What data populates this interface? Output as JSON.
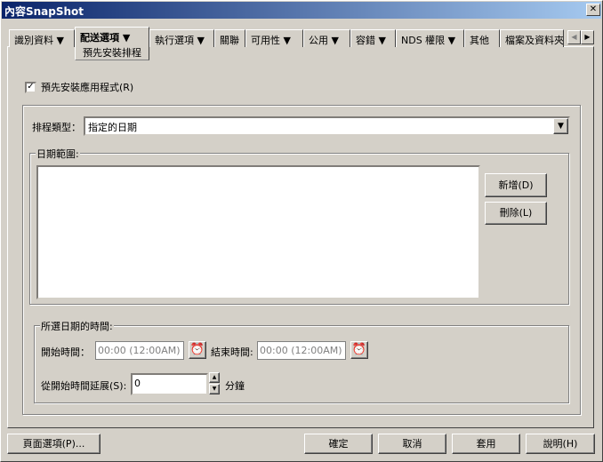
{
  "window": {
    "title": "內容SnapShot",
    "close": "✕"
  },
  "tabs": [
    {
      "label": "識別資料 ▼"
    },
    {
      "label": "配送選項  ▼",
      "sub": "預先安裝排程"
    },
    {
      "label": "執行選項 ▼"
    },
    {
      "label": "關聯"
    },
    {
      "label": "可用性 ▼"
    },
    {
      "label": "公用 ▼"
    },
    {
      "label": "容錯 ▼"
    },
    {
      "label": "NDS 權限 ▼"
    },
    {
      "label": "其他"
    },
    {
      "label": "檔案及資料夾"
    }
  ],
  "preinstall_checkbox": {
    "label": "預先安裝應用程式(R)",
    "checked": true
  },
  "schedule_type": {
    "label": "排程類型：",
    "value": "指定的日期"
  },
  "date_range": {
    "legend": "日期範圍:",
    "add": "新增(D)",
    "delete": "刪除(L)"
  },
  "time_group": {
    "legend": "所選日期的時間:",
    "start_label": "開始時間：",
    "start_value": "00:00 (12:00AM)",
    "end_label": "結束時間:",
    "end_value": "00:00 (12:00AM)",
    "spread_label": "從開始時間延展(S):",
    "spread_value": "0",
    "unit": "分鐘"
  },
  "buttons": {
    "page_options": "頁面選項(P)...",
    "ok": "確定",
    "cancel": "取消",
    "apply": "套用",
    "help": "說明(H)"
  }
}
